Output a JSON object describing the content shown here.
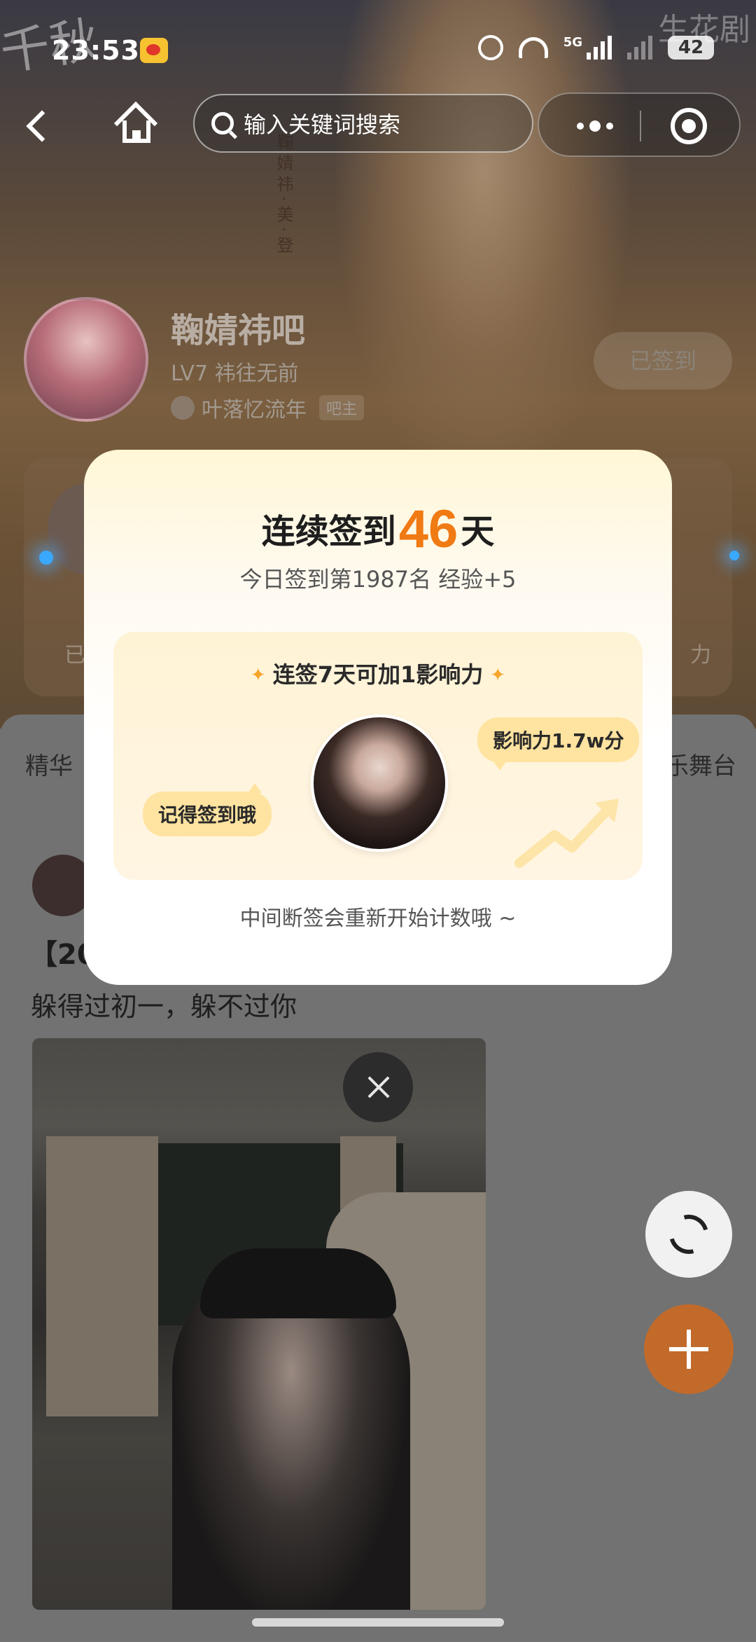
{
  "status_bar": {
    "time": "23:53",
    "network": "5G",
    "battery": "42"
  },
  "watermark": "生花剧",
  "header": {
    "search_placeholder": "输入关键词搜索",
    "calligraphy": "千秋",
    "poster_vertical_text": "鞠婧祎·美·登"
  },
  "forum": {
    "name": "鞠婧祎吧",
    "level": "LV7 祎往无前",
    "owner_name": "叶落忆流年",
    "owner_badge": "吧主",
    "sign_button": "已签到"
  },
  "bg_card": {
    "left_fragment": "已",
    "right_fragment": "力"
  },
  "tabs": {
    "left": "精华",
    "right": "乐舞台"
  },
  "post": {
    "title_fragment": "【20",
    "text": "躲得过初一，躲不过你"
  },
  "modal": {
    "title_prefix": "连续签到",
    "days": "46",
    "title_suffix": "天",
    "subtitle": "今日签到第1987名 经验+5",
    "reward_head": "连签7天可加1影响力",
    "influence_bubble": "影响力1.7w分",
    "reminder_bubble": "记得签到哦",
    "footer": "中间断签会重新开始计数哦 ~"
  },
  "colors": {
    "accent_orange": "#f07a14",
    "fab_orange": "#c26a2a",
    "bubble": "#ffe3a0"
  },
  "icons": [
    "back-icon",
    "home-icon",
    "search-icon",
    "more-icon",
    "target-icon",
    "close-icon",
    "refresh-icon",
    "add-icon"
  ]
}
